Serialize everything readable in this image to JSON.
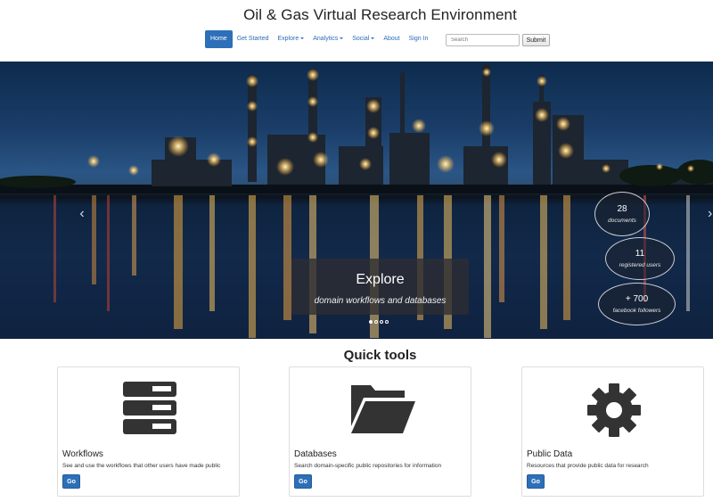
{
  "site": {
    "title": "Oil & Gas Virtual Research Environment"
  },
  "nav": {
    "items": [
      {
        "label": "Home",
        "active": true
      },
      {
        "label": "Get Started",
        "dropdown": false
      },
      {
        "label": "Explore",
        "dropdown": true
      },
      {
        "label": "Analytics",
        "dropdown": true
      },
      {
        "label": "Social",
        "dropdown": true
      },
      {
        "label": "About",
        "dropdown": false
      },
      {
        "label": "Sign In",
        "dropdown": false
      }
    ]
  },
  "search": {
    "placeholder": "Search",
    "submit_label": "Submit"
  },
  "hero": {
    "caption_title": "Explore",
    "caption_subtitle": "domain workflows and databases",
    "slide_count": 4,
    "active_slide": 1,
    "stats": [
      {
        "value": "28",
        "label": "documents"
      },
      {
        "value": "11",
        "label": "registered users"
      },
      {
        "value": "+ 700",
        "label": "facebook followers"
      }
    ]
  },
  "quick_tools": {
    "title": "Quick tools",
    "cards": [
      {
        "title": "Workflows",
        "description": "See and use the workflows that other users have made public",
        "button_label": "Go",
        "icon": "server-stack-icon"
      },
      {
        "title": "Databases",
        "description": "Search domain-specific public repositories for information",
        "button_label": "Go",
        "icon": "folder-open-icon"
      },
      {
        "title": "Public Data",
        "description": "Resources that provide public data for research",
        "button_label": "Go",
        "icon": "gear-icon"
      }
    ]
  },
  "colors": {
    "accent": "#2d6fb8",
    "link": "#2a6db5",
    "icon": "#333333"
  }
}
